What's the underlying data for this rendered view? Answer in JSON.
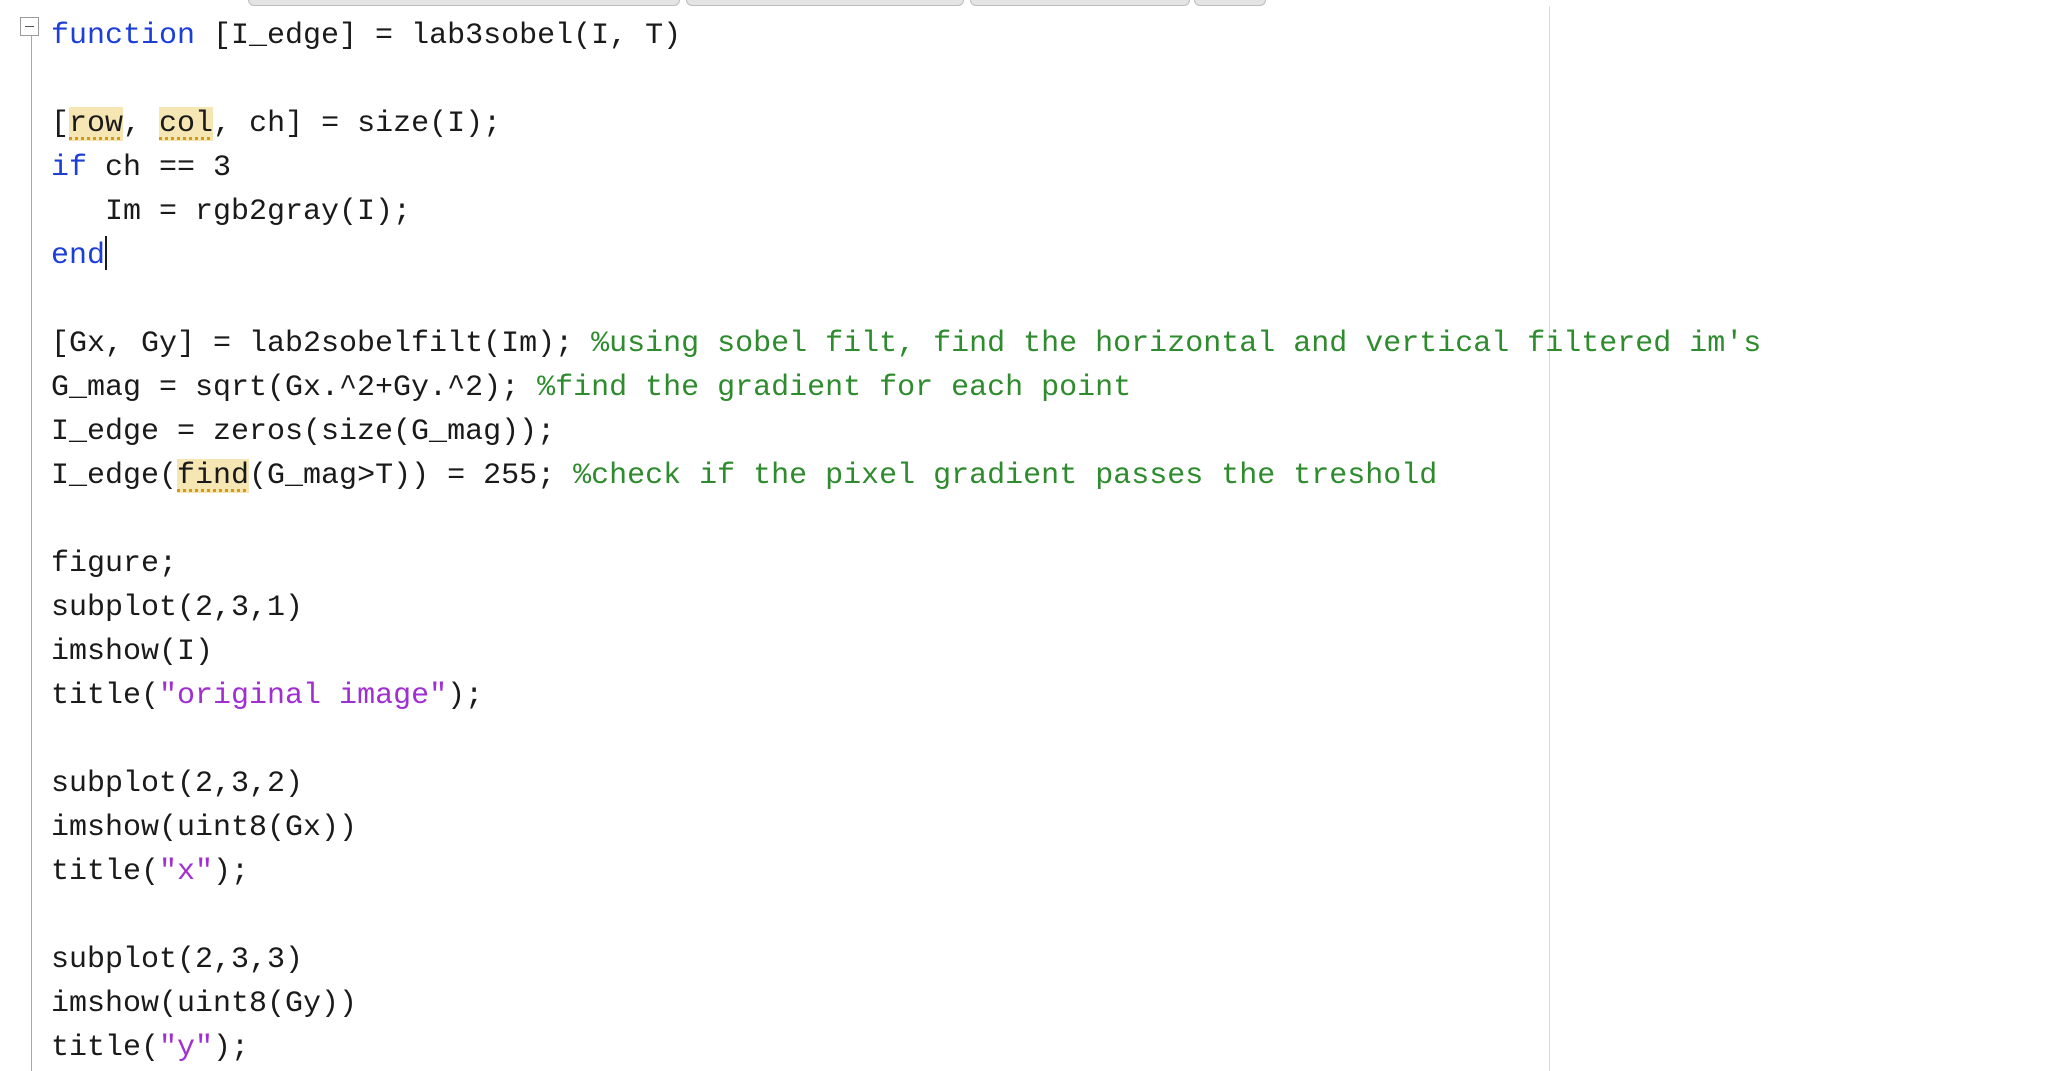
{
  "editor": {
    "lines": [
      [
        {
          "t": "function",
          "c": "kw"
        },
        {
          "t": " [I_edge] = lab3sobel(I, T)"
        }
      ],
      [],
      [
        {
          "t": "["
        },
        {
          "t": "row",
          "c": "hl"
        },
        {
          "t": ", "
        },
        {
          "t": "col",
          "c": "hl"
        },
        {
          "t": ", ch] = size(I);"
        }
      ],
      [
        {
          "t": "if",
          "c": "kw"
        },
        {
          "t": " ch == 3"
        }
      ],
      [
        {
          "t": "   Im = rgb2gray(I);"
        }
      ],
      [
        {
          "t": "end",
          "c": "kw"
        },
        {
          "caret": true
        }
      ],
      [],
      [
        {
          "t": "[Gx, Gy] = lab2sobelfilt(Im); "
        },
        {
          "t": "%using sobel filt, find the horizontal and vertical filtered im's",
          "c": "cm"
        }
      ],
      [
        {
          "t": "G_mag = sqrt(Gx.^2+Gy.^2); "
        },
        {
          "t": "%find the gradient for each point",
          "c": "cm"
        }
      ],
      [
        {
          "t": "I_edge = zeros(size(G_mag));"
        }
      ],
      [
        {
          "t": "I_edge("
        },
        {
          "t": "find",
          "c": "hl"
        },
        {
          "t": "(G_mag>T)) = 255; "
        },
        {
          "t": "%check if the pixel gradient passes the treshold",
          "c": "cm"
        }
      ],
      [],
      [
        {
          "t": "figure;"
        }
      ],
      [
        {
          "t": "subplot(2,3,1)"
        }
      ],
      [
        {
          "t": "imshow(I)"
        }
      ],
      [
        {
          "t": "title("
        },
        {
          "t": "\"original image\"",
          "c": "st"
        },
        {
          "t": ");"
        }
      ],
      [],
      [
        {
          "t": "subplot(2,3,2)"
        }
      ],
      [
        {
          "t": "imshow(uint8(Gx))"
        }
      ],
      [
        {
          "t": "title("
        },
        {
          "t": "\"x\"",
          "c": "st"
        },
        {
          "t": ");"
        }
      ],
      [],
      [
        {
          "t": "subplot(2,3,3)"
        }
      ],
      [
        {
          "t": "imshow(uint8(Gy))"
        }
      ],
      [
        {
          "t": "title("
        },
        {
          "t": "\"y\"",
          "c": "st"
        },
        {
          "t": ");"
        }
      ]
    ]
  },
  "colors": {
    "keyword": "#1d3fd6",
    "comment": "#2e8b2e",
    "string": "#a02fd1",
    "highlight": "#f5e6b3",
    "text": "#1a1a1a"
  },
  "icons": {
    "fold": "fold-collapse-icon"
  }
}
